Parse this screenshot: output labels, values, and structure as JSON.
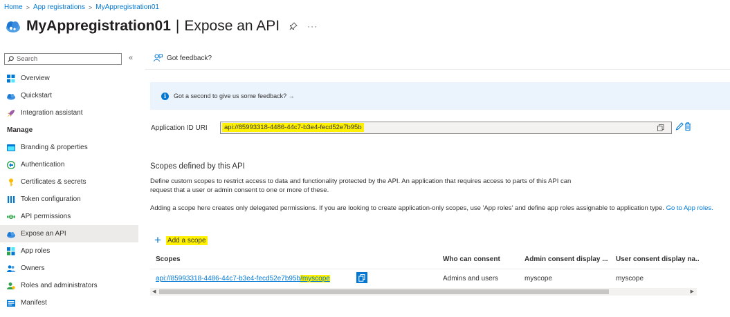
{
  "breadcrumb": {
    "items": [
      "Home",
      "App registrations",
      "MyAppregistration01"
    ],
    "separator": ">"
  },
  "header": {
    "app_name": "MyAppregistration01",
    "divider": "|",
    "page": "Expose an API",
    "pin_icon": "pin-icon",
    "more": "···"
  },
  "sidebar": {
    "search_placeholder": "Search",
    "collapse_glyph": "«",
    "items_top": [
      {
        "label": "Overview",
        "icon": "overview-icon"
      },
      {
        "label": "Quickstart",
        "icon": "quickstart-icon"
      },
      {
        "label": "Integration assistant",
        "icon": "rocket-icon"
      }
    ],
    "section_label": "Manage",
    "items_manage": [
      {
        "label": "Branding & properties",
        "icon": "branding-icon"
      },
      {
        "label": "Authentication",
        "icon": "authentication-icon"
      },
      {
        "label": "Certificates & secrets",
        "icon": "key-icon"
      },
      {
        "label": "Token configuration",
        "icon": "token-icon"
      },
      {
        "label": "API permissions",
        "icon": "api-permissions-icon"
      },
      {
        "label": "Expose an API",
        "icon": "cloud-icon",
        "active": true
      },
      {
        "label": "App roles",
        "icon": "app-roles-icon"
      },
      {
        "label": "Owners",
        "icon": "owners-icon"
      },
      {
        "label": "Roles and administrators",
        "icon": "roles-icon"
      },
      {
        "label": "Manifest",
        "icon": "manifest-icon"
      }
    ]
  },
  "toolbar": {
    "feedback_label": "Got feedback?"
  },
  "banner": {
    "text": "Got a second to give us some feedback? →"
  },
  "application_id": {
    "label": "Application ID URI",
    "value": "api://85993318-4486-44c7-b3e4-fecd52e7b95b"
  },
  "scopes_section": {
    "heading": "Scopes defined by this API",
    "description_1": "Define custom scopes to restrict access to data and functionality protected by the API. An application that requires access to parts of this API can request that a user or admin consent to one or more of these.",
    "description_2_prefix": "Adding a scope here creates only delegated permissions. If you are looking to create application-only scopes, use 'App roles' and define app roles assignable to application type.",
    "description_2_link": "Go to App roles.",
    "add_scope_label": "Add a scope"
  },
  "table": {
    "headers": [
      "Scopes",
      "Who can consent",
      "Admin consent display ...",
      "User consent display na.."
    ],
    "rows": [
      {
        "scope_prefix": "api://85993318-4486-44c7-b3e4-fecd52e7b95b",
        "scope_suffix": "/myscope",
        "who": "Admins and users",
        "admin_display": "myscope",
        "user_display": "myscope"
      }
    ]
  },
  "colors": {
    "accent": "#0078d4",
    "highlight": "#fff100",
    "banner_bg": "#ebf3fc",
    "active_nav": "#edebe9"
  }
}
